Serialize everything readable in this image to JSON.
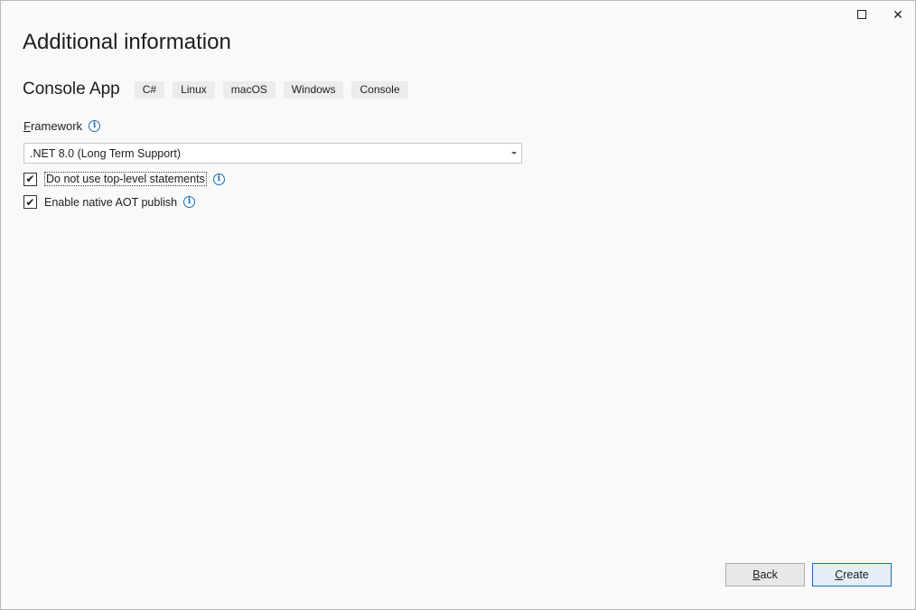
{
  "window": {
    "maximize_icon": "maximize-icon",
    "close_icon": "close-icon",
    "close_glyph": "✕"
  },
  "page": {
    "title": "Additional information"
  },
  "template": {
    "name": "Console App",
    "tags": [
      "C#",
      "Linux",
      "macOS",
      "Windows",
      "Console"
    ]
  },
  "framework": {
    "label": "Framework",
    "selected": ".NET 8.0 (Long Term Support)"
  },
  "options": [
    {
      "label": "Do not use top-level statements",
      "checked": true
    },
    {
      "label": "Enable native AOT publish",
      "checked": true
    }
  ],
  "buttons": {
    "back": "Back",
    "create": "Create"
  },
  "colors": {
    "accent": "#1c6fb5",
    "background": "#f9f9f9"
  }
}
